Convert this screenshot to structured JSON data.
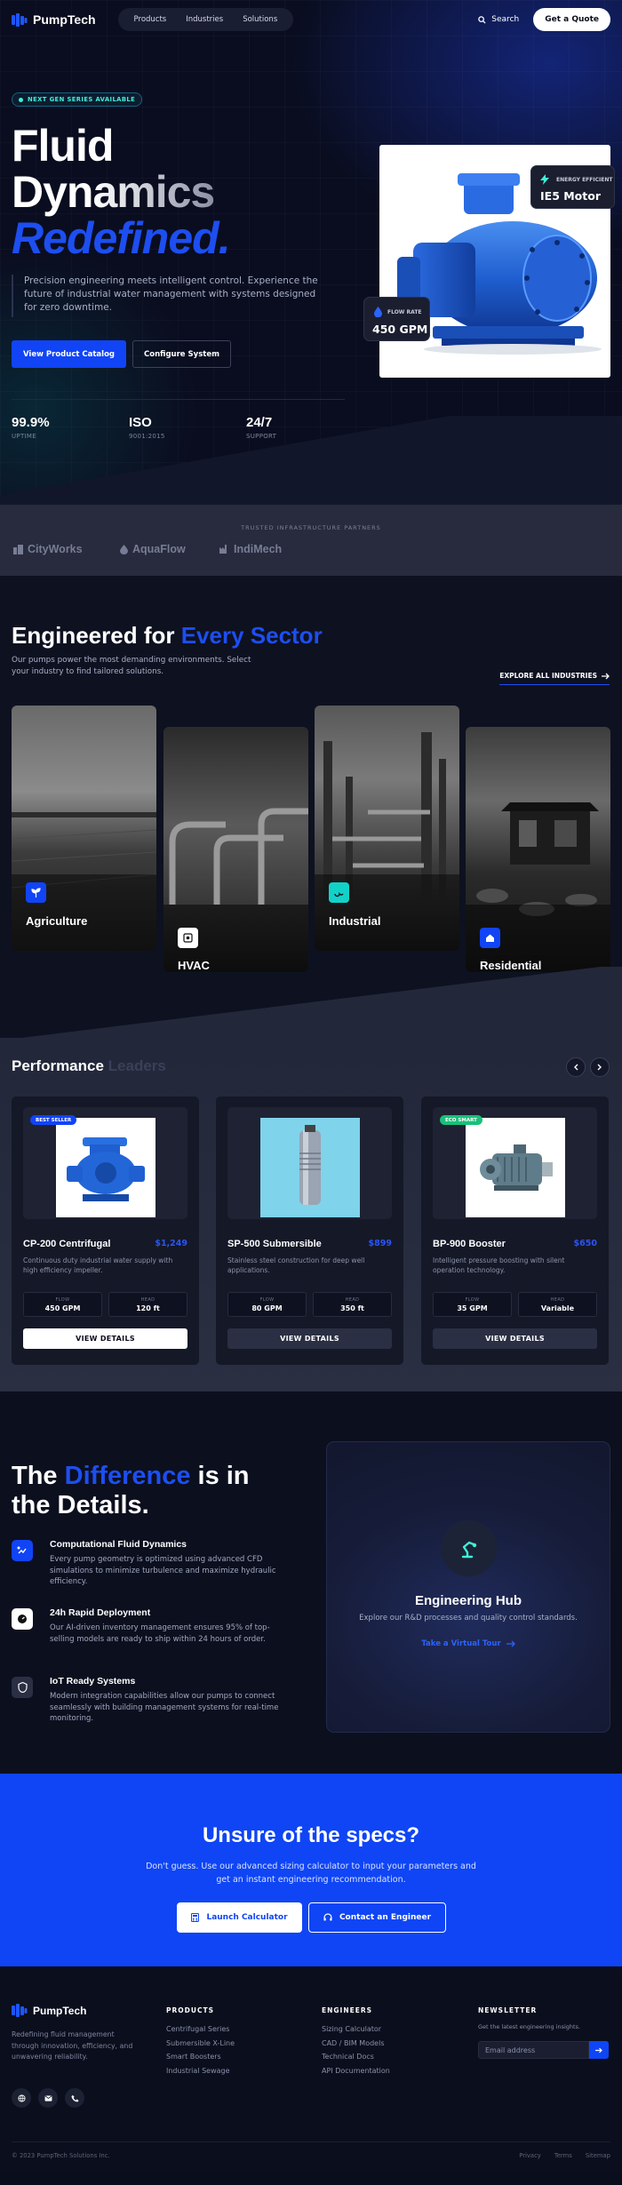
{
  "nav": {
    "brand": "PumpTech",
    "menu": [
      "Products",
      "Industries",
      "Solutions"
    ],
    "search": "Search",
    "quote": "Get a Quote"
  },
  "hero": {
    "badge": "NEXT GEN SERIES AVAILABLE",
    "title_line1": "Fluid",
    "title_line2": "Dynamics",
    "title_line3": "Redefined.",
    "paragraph": "Precision engineering meets intelligent control. Experience the future of industrial water management with systems designed for zero downtime.",
    "primary_cta": "View Product Catalog",
    "secondary_cta": "Configure System",
    "stats": [
      {
        "value": "99.9%",
        "label": "UPTIME"
      },
      {
        "value": "ISO",
        "label": "9001:2015"
      },
      {
        "value": "24/7",
        "label": "SUPPORT"
      }
    ],
    "chip_energy": {
      "label": "ENERGY EFFICIENT",
      "value": "IE5 Motor"
    },
    "chip_flow": {
      "label": "FLOW RATE",
      "value": "450 GPM"
    }
  },
  "partners": {
    "caption": "TRUSTED INFRASTRUCTURE PARTNERS",
    "logos": [
      "CityWorks",
      "AquaFlow",
      "IndiMech"
    ]
  },
  "sectors": {
    "title_plain": "Engineered for ",
    "title_accent": "Every Sector",
    "paragraph": "Our pumps power the most demanding environments. Select your industry to find tailored solutions.",
    "explore": "EXPLORE ALL INDUSTRIES",
    "cards": [
      {
        "label": "Agriculture",
        "icon": "sprout-icon"
      },
      {
        "label": "HVAC",
        "icon": "fan-icon"
      },
      {
        "label": "Industrial",
        "icon": "factory-icon"
      },
      {
        "label": "Residential",
        "icon": "home-icon"
      }
    ]
  },
  "performance": {
    "title_plain": "Performance ",
    "title_dim": "Leaders",
    "products": [
      {
        "tag": "BEST SELLER",
        "name": "CP-200 Centrifugal",
        "price": "$1,249",
        "desc": "Continuous duty industrial water supply with high efficiency impeller.",
        "spec1_label": "FLOW",
        "spec1_value": "450 GPM",
        "spec2_label": "HEAD",
        "spec2_value": "120 ft",
        "button": "VIEW DETAILS"
      },
      {
        "tag": "",
        "name": "SP-500 Submersible",
        "price": "$899",
        "desc": "Stainless steel construction for deep well applications.",
        "spec1_label": "FLOW",
        "spec1_value": "80 GPM",
        "spec2_label": "HEAD",
        "spec2_value": "350 ft",
        "button": "VIEW DETAILS"
      },
      {
        "tag": "ECO SMART",
        "name": "BP-900 Booster",
        "price": "$650",
        "desc": "Intelligent pressure boosting with silent operation technology.",
        "spec1_label": "FLOW",
        "spec1_value": "35 GPM",
        "spec2_label": "HEAD",
        "spec2_value": "Variable",
        "button": "VIEW DETAILS"
      }
    ]
  },
  "difference": {
    "title_a": "The ",
    "title_accent": "Difference",
    "title_b": " is in",
    "title_line2": "the Details.",
    "features": [
      {
        "title": "Computational Fluid Dynamics",
        "desc": "Every pump geometry is optimized using advanced CFD simulations to minimize turbulence and maximize hydraulic efficiency."
      },
      {
        "title": "24h Rapid Deployment",
        "desc": "Our AI-driven inventory management ensures 95% of top-selling models are ready to ship within 24 hours of order."
      },
      {
        "title": "IoT Ready Systems",
        "desc": "Modern integration capabilities allow our pumps to connect seamlessly with building management systems for real-time monitoring."
      }
    ],
    "hub": {
      "title": "Engineering Hub",
      "desc": "Explore our R&D processes and quality control standards.",
      "link": "Take a Virtual Tour"
    }
  },
  "cta": {
    "title": "Unsure of the specs?",
    "paragraph": "Don't guess. Use our advanced sizing calculator to input your parameters and get an instant engineering recommendation.",
    "btn1": "Launch Calculator",
    "btn2": "Contact an Engineer"
  },
  "footer": {
    "brand": "PumpTech",
    "desc": "Redefining fluid management through innovation, efficiency, and unwavering reliability.",
    "products_title": "PRODUCTS",
    "products": [
      "Centrifugal Series",
      "Submersible X-Line",
      "Smart Boosters",
      "Industrial Sewage"
    ],
    "engineers_title": "ENGINEERS",
    "engineers": [
      "Sizing Calculator",
      "CAD / BIM Models",
      "Technical Docs",
      "API Documentation"
    ],
    "newsletter_title": "NEWSLETTER",
    "newsletter_desc": "Get the latest engineering insights.",
    "email_placeholder": "Email address",
    "copyright": "© 2023 PumpTech Solutions Inc.",
    "links": [
      "Privacy",
      "Terms",
      "Sitemap"
    ]
  },
  "colors": {
    "accent": "#1144f5",
    "teal": "#3ef0d8",
    "bg": "#0a0d1c"
  }
}
